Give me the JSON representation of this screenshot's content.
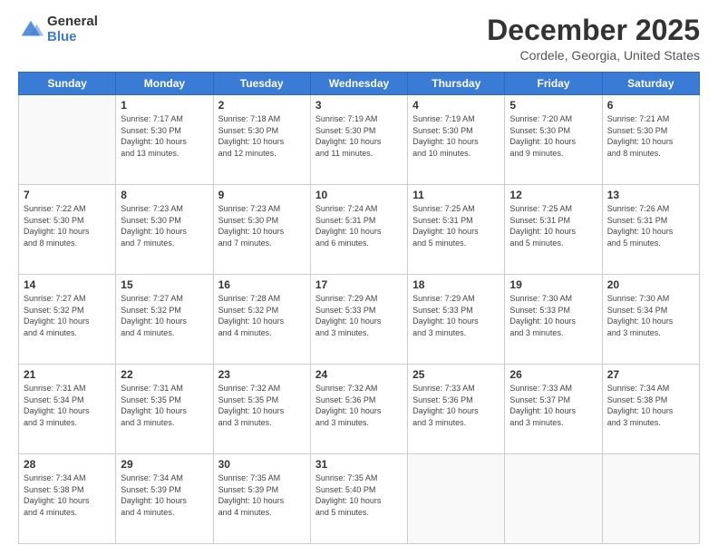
{
  "logo": {
    "line1": "General",
    "line2": "Blue"
  },
  "header": {
    "month": "December 2025",
    "location": "Cordele, Georgia, United States"
  },
  "weekdays": [
    "Sunday",
    "Monday",
    "Tuesday",
    "Wednesday",
    "Thursday",
    "Friday",
    "Saturday"
  ],
  "weeks": [
    [
      {
        "day": "",
        "info": ""
      },
      {
        "day": "1",
        "info": "Sunrise: 7:17 AM\nSunset: 5:30 PM\nDaylight: 10 hours\nand 13 minutes."
      },
      {
        "day": "2",
        "info": "Sunrise: 7:18 AM\nSunset: 5:30 PM\nDaylight: 10 hours\nand 12 minutes."
      },
      {
        "day": "3",
        "info": "Sunrise: 7:19 AM\nSunset: 5:30 PM\nDaylight: 10 hours\nand 11 minutes."
      },
      {
        "day": "4",
        "info": "Sunrise: 7:19 AM\nSunset: 5:30 PM\nDaylight: 10 hours\nand 10 minutes."
      },
      {
        "day": "5",
        "info": "Sunrise: 7:20 AM\nSunset: 5:30 PM\nDaylight: 10 hours\nand 9 minutes."
      },
      {
        "day": "6",
        "info": "Sunrise: 7:21 AM\nSunset: 5:30 PM\nDaylight: 10 hours\nand 8 minutes."
      }
    ],
    [
      {
        "day": "7",
        "info": "Sunrise: 7:22 AM\nSunset: 5:30 PM\nDaylight: 10 hours\nand 8 minutes."
      },
      {
        "day": "8",
        "info": "Sunrise: 7:23 AM\nSunset: 5:30 PM\nDaylight: 10 hours\nand 7 minutes."
      },
      {
        "day": "9",
        "info": "Sunrise: 7:23 AM\nSunset: 5:30 PM\nDaylight: 10 hours\nand 7 minutes."
      },
      {
        "day": "10",
        "info": "Sunrise: 7:24 AM\nSunset: 5:31 PM\nDaylight: 10 hours\nand 6 minutes."
      },
      {
        "day": "11",
        "info": "Sunrise: 7:25 AM\nSunset: 5:31 PM\nDaylight: 10 hours\nand 5 minutes."
      },
      {
        "day": "12",
        "info": "Sunrise: 7:25 AM\nSunset: 5:31 PM\nDaylight: 10 hours\nand 5 minutes."
      },
      {
        "day": "13",
        "info": "Sunrise: 7:26 AM\nSunset: 5:31 PM\nDaylight: 10 hours\nand 5 minutes."
      }
    ],
    [
      {
        "day": "14",
        "info": "Sunrise: 7:27 AM\nSunset: 5:32 PM\nDaylight: 10 hours\nand 4 minutes."
      },
      {
        "day": "15",
        "info": "Sunrise: 7:27 AM\nSunset: 5:32 PM\nDaylight: 10 hours\nand 4 minutes."
      },
      {
        "day": "16",
        "info": "Sunrise: 7:28 AM\nSunset: 5:32 PM\nDaylight: 10 hours\nand 4 minutes."
      },
      {
        "day": "17",
        "info": "Sunrise: 7:29 AM\nSunset: 5:33 PM\nDaylight: 10 hours\nand 3 minutes."
      },
      {
        "day": "18",
        "info": "Sunrise: 7:29 AM\nSunset: 5:33 PM\nDaylight: 10 hours\nand 3 minutes."
      },
      {
        "day": "19",
        "info": "Sunrise: 7:30 AM\nSunset: 5:33 PM\nDaylight: 10 hours\nand 3 minutes."
      },
      {
        "day": "20",
        "info": "Sunrise: 7:30 AM\nSunset: 5:34 PM\nDaylight: 10 hours\nand 3 minutes."
      }
    ],
    [
      {
        "day": "21",
        "info": "Sunrise: 7:31 AM\nSunset: 5:34 PM\nDaylight: 10 hours\nand 3 minutes."
      },
      {
        "day": "22",
        "info": "Sunrise: 7:31 AM\nSunset: 5:35 PM\nDaylight: 10 hours\nand 3 minutes."
      },
      {
        "day": "23",
        "info": "Sunrise: 7:32 AM\nSunset: 5:35 PM\nDaylight: 10 hours\nand 3 minutes."
      },
      {
        "day": "24",
        "info": "Sunrise: 7:32 AM\nSunset: 5:36 PM\nDaylight: 10 hours\nand 3 minutes."
      },
      {
        "day": "25",
        "info": "Sunrise: 7:33 AM\nSunset: 5:36 PM\nDaylight: 10 hours\nand 3 minutes."
      },
      {
        "day": "26",
        "info": "Sunrise: 7:33 AM\nSunset: 5:37 PM\nDaylight: 10 hours\nand 3 minutes."
      },
      {
        "day": "27",
        "info": "Sunrise: 7:34 AM\nSunset: 5:38 PM\nDaylight: 10 hours\nand 3 minutes."
      }
    ],
    [
      {
        "day": "28",
        "info": "Sunrise: 7:34 AM\nSunset: 5:38 PM\nDaylight: 10 hours\nand 4 minutes."
      },
      {
        "day": "29",
        "info": "Sunrise: 7:34 AM\nSunset: 5:39 PM\nDaylight: 10 hours\nand 4 minutes."
      },
      {
        "day": "30",
        "info": "Sunrise: 7:35 AM\nSunset: 5:39 PM\nDaylight: 10 hours\nand 4 minutes."
      },
      {
        "day": "31",
        "info": "Sunrise: 7:35 AM\nSunset: 5:40 PM\nDaylight: 10 hours\nand 5 minutes."
      },
      {
        "day": "",
        "info": ""
      },
      {
        "day": "",
        "info": ""
      },
      {
        "day": "",
        "info": ""
      }
    ]
  ]
}
